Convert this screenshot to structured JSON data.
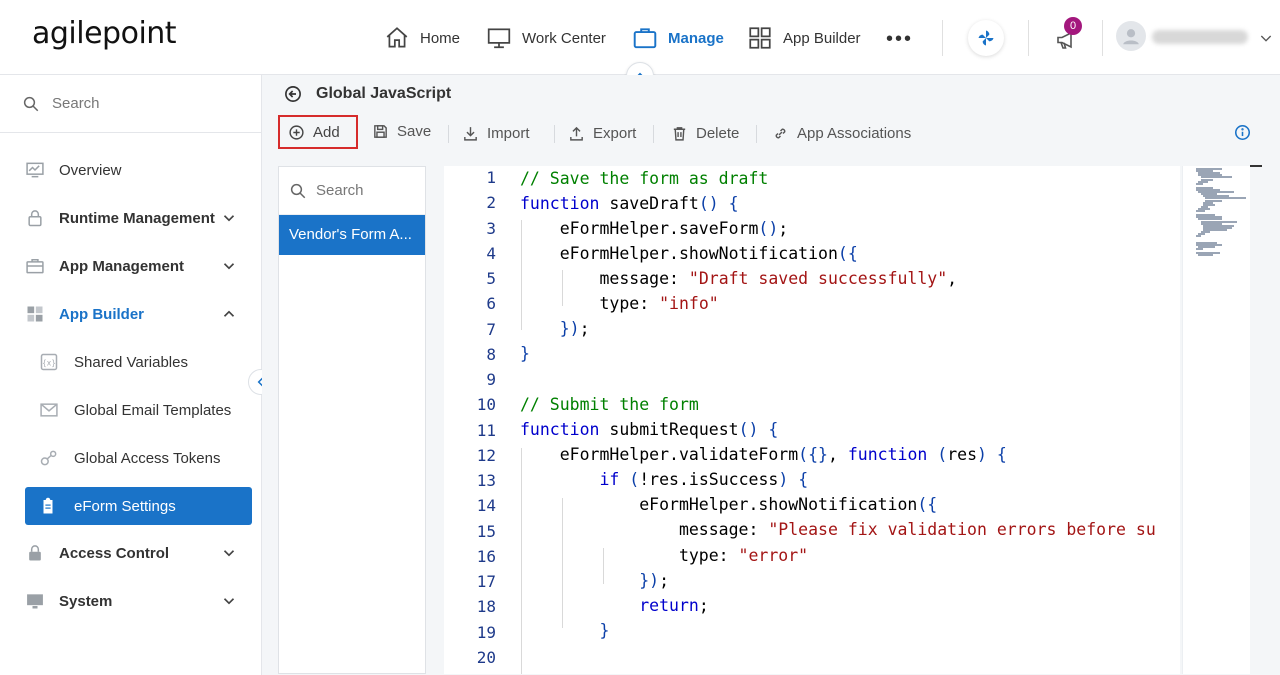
{
  "app": {
    "logo_text": "agilepoint"
  },
  "nav": {
    "home": "Home",
    "work_center": "Work Center",
    "manage": "Manage",
    "app_builder": "App Builder",
    "more": "•••",
    "notifications_count": "0"
  },
  "sidebar": {
    "search_placeholder": "Search",
    "items": [
      {
        "label": "Overview",
        "icon": "chart-icon"
      },
      {
        "label": "Runtime Management",
        "icon": "lock-icon"
      },
      {
        "label": "App Management",
        "icon": "briefcase-icon"
      },
      {
        "label": "App Builder",
        "icon": "grid-icon"
      },
      {
        "label": "Shared Variables",
        "icon": "variable-icon"
      },
      {
        "label": "Global Email Templates",
        "icon": "envelope-icon"
      },
      {
        "label": "Global Access Tokens",
        "icon": "token-icon"
      },
      {
        "label": "eForm Settings",
        "icon": "clipboard-icon"
      },
      {
        "label": "Access Control",
        "icon": "lock-icon"
      },
      {
        "label": "System",
        "icon": "monitor-icon"
      }
    ]
  },
  "page": {
    "title": "Global JavaScript"
  },
  "toolbar": {
    "add": "Add",
    "save": "Save",
    "import": "Import",
    "export": "Export",
    "delete": "Delete",
    "app_associations": "App Associations"
  },
  "list": {
    "search_placeholder": "Search",
    "items": [
      "Vendor's Form A..."
    ]
  },
  "editor": {
    "line_numbers": [
      "1",
      "2",
      "3",
      "4",
      "5",
      "6",
      "7",
      "8",
      "9",
      "10",
      "11",
      "12",
      "13",
      "14",
      "15",
      "16",
      "17",
      "18",
      "19",
      "20"
    ]
  },
  "colors": {
    "accent": "#1a73c8",
    "highlight_border": "#d62b2b",
    "badge": "#a3177d"
  }
}
